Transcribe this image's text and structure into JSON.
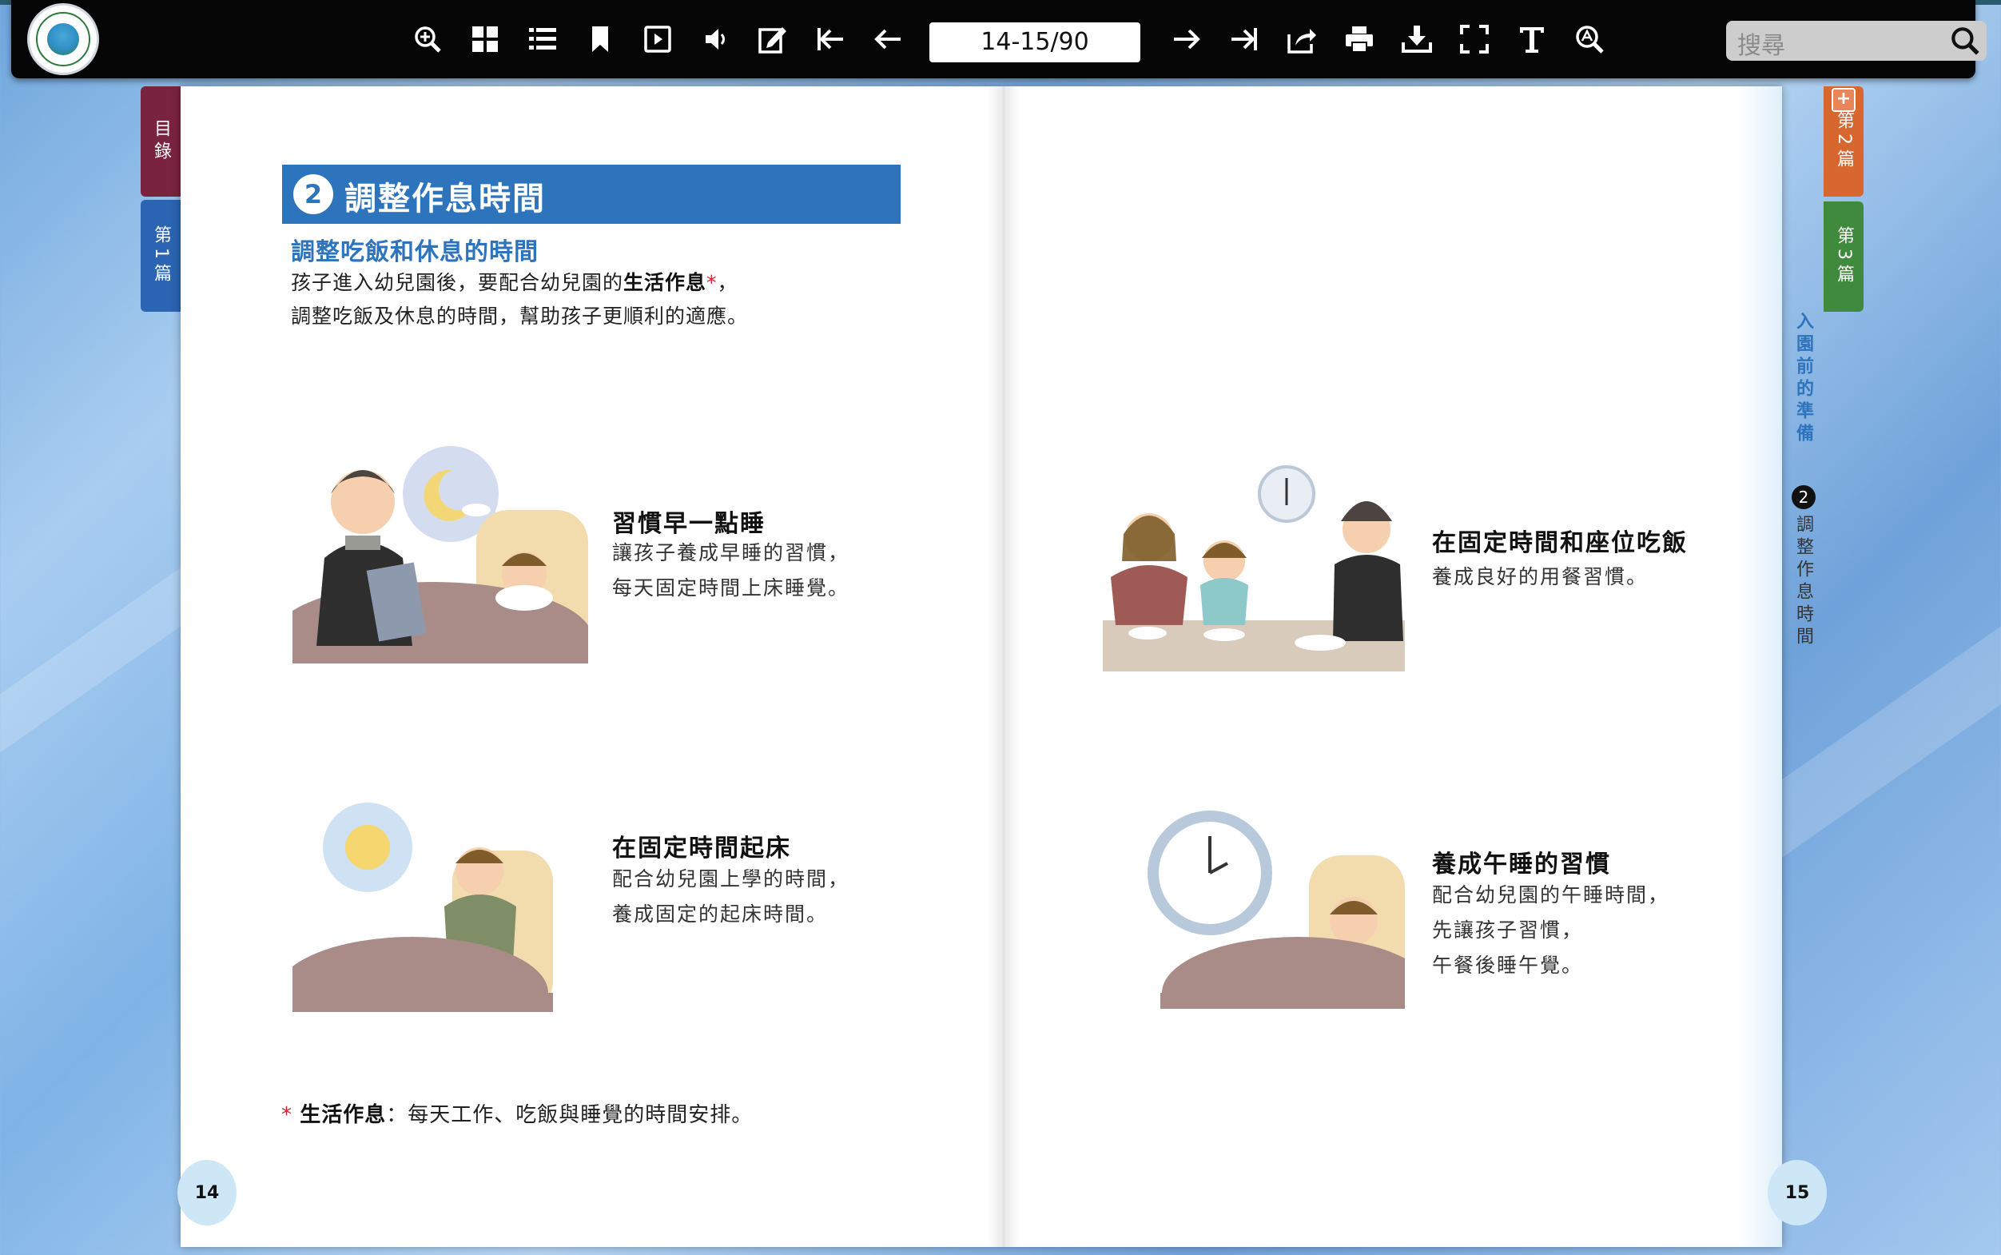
{
  "toolbar": {
    "page_indicator": "14-15/90",
    "search_placeholder": "搜尋"
  },
  "tabs": {
    "left": [
      {
        "label": "目錄",
        "color": "#7a2340"
      },
      {
        "label": "第1篇",
        "color": "#2b64b3"
      }
    ],
    "right": [
      {
        "label": "第2篇",
        "color": "#d8672f"
      },
      {
        "label": "第3篇",
        "color": "#3f8a3c"
      }
    ]
  },
  "left_page": {
    "section_number": "2",
    "section_title": "調整作息時間",
    "subheading": "調整吃飯和休息的時間",
    "intro_line1_a": "孩子進入幼兒園後，要配合幼兒園的",
    "intro_line1_bold": "生活作息",
    "intro_line1_star": "*",
    "intro_line1_c": "，",
    "intro_line2": "調整吃飯及休息的時間，幫助孩子更順利的適應。",
    "items": [
      {
        "title": "習慣早一點睡",
        "lines": [
          "讓孩子養成早睡的習慣，",
          "每天固定時間上床睡覺。"
        ]
      },
      {
        "title": "在固定時間起床",
        "lines": [
          "配合幼兒園上學的時間，",
          "養成固定的起床時間。"
        ]
      }
    ],
    "footnote_star": "*",
    "footnote_term": "生活作息",
    "footnote_text": "：每天工作、吃飯與睡覺的時間安排。",
    "page_number": "14"
  },
  "right_page": {
    "items": [
      {
        "title": "在固定時間和座位吃飯",
        "lines": [
          "養成良好的用餐習慣。"
        ]
      },
      {
        "title": "養成午睡的習慣",
        "lines": [
          "配合幼兒園的午睡時間，",
          "先讓孩子習慣，",
          "午餐後睡午覺。"
        ]
      }
    ],
    "side_chapter": "入園前的準備",
    "side_section_number": "2",
    "side_section": "調整作息時間",
    "page_number": "15"
  },
  "colors": {
    "accent_blue": "#2e74bd",
    "toolbar_bg": "#050505"
  }
}
